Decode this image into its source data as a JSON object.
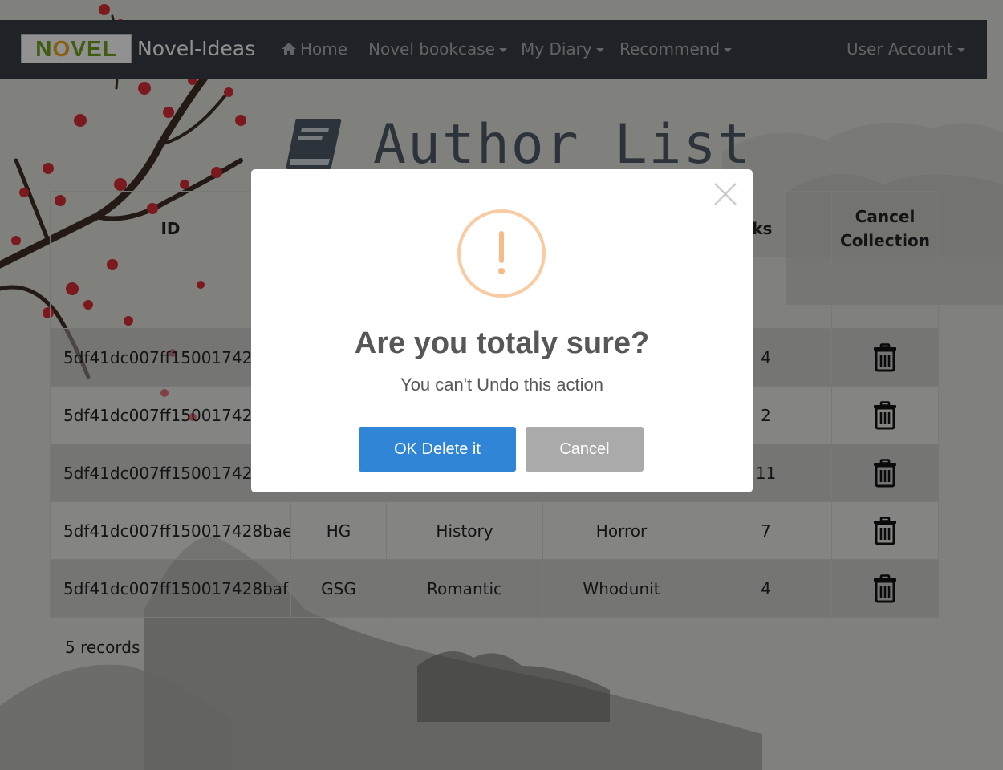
{
  "navbar": {
    "logo_text": "NOVEL",
    "brand": "Novel-Ideas",
    "home": "Home",
    "bookcase": "Novel bookcase",
    "diary": "My Diary",
    "recommend": "Recommend",
    "account": "User Account"
  },
  "page": {
    "title": "Author List"
  },
  "table": {
    "headers": {
      "id": "ID",
      "count": "ofbooks",
      "cancel": "Cancel Collection"
    },
    "rows": [
      {
        "id": "5df41dc007ff150017428b",
        "c1": "",
        "c2": "",
        "c3": "",
        "count": "4"
      },
      {
        "id": "5df41dc007ff150017428",
        "c1": "",
        "c2": "",
        "c3": "",
        "count": "2"
      },
      {
        "id": "5df41dc007ff150017428b",
        "c1": "",
        "c2": "",
        "c3": "",
        "count": "11"
      },
      {
        "id": "5df41dc007ff150017428bae",
        "c1": "HG",
        "c2": "History",
        "c3": "Horror",
        "count": "7"
      },
      {
        "id": "5df41dc007ff150017428baf",
        "c1": "GSG",
        "c2": "Romantic",
        "c3": "Whodunit",
        "count": "4"
      }
    ],
    "records": "5 records"
  },
  "modal": {
    "icon": "!",
    "title": "Are you totaly sure?",
    "text": "You can't Undo this action",
    "ok_label": "OK Delete it",
    "cancel_label": "Cancel"
  },
  "colors": {
    "navbar": "#343a40",
    "ok_button": "#3085d6",
    "cancel_button": "#aaaaaa",
    "warning": "#f8bb86"
  }
}
